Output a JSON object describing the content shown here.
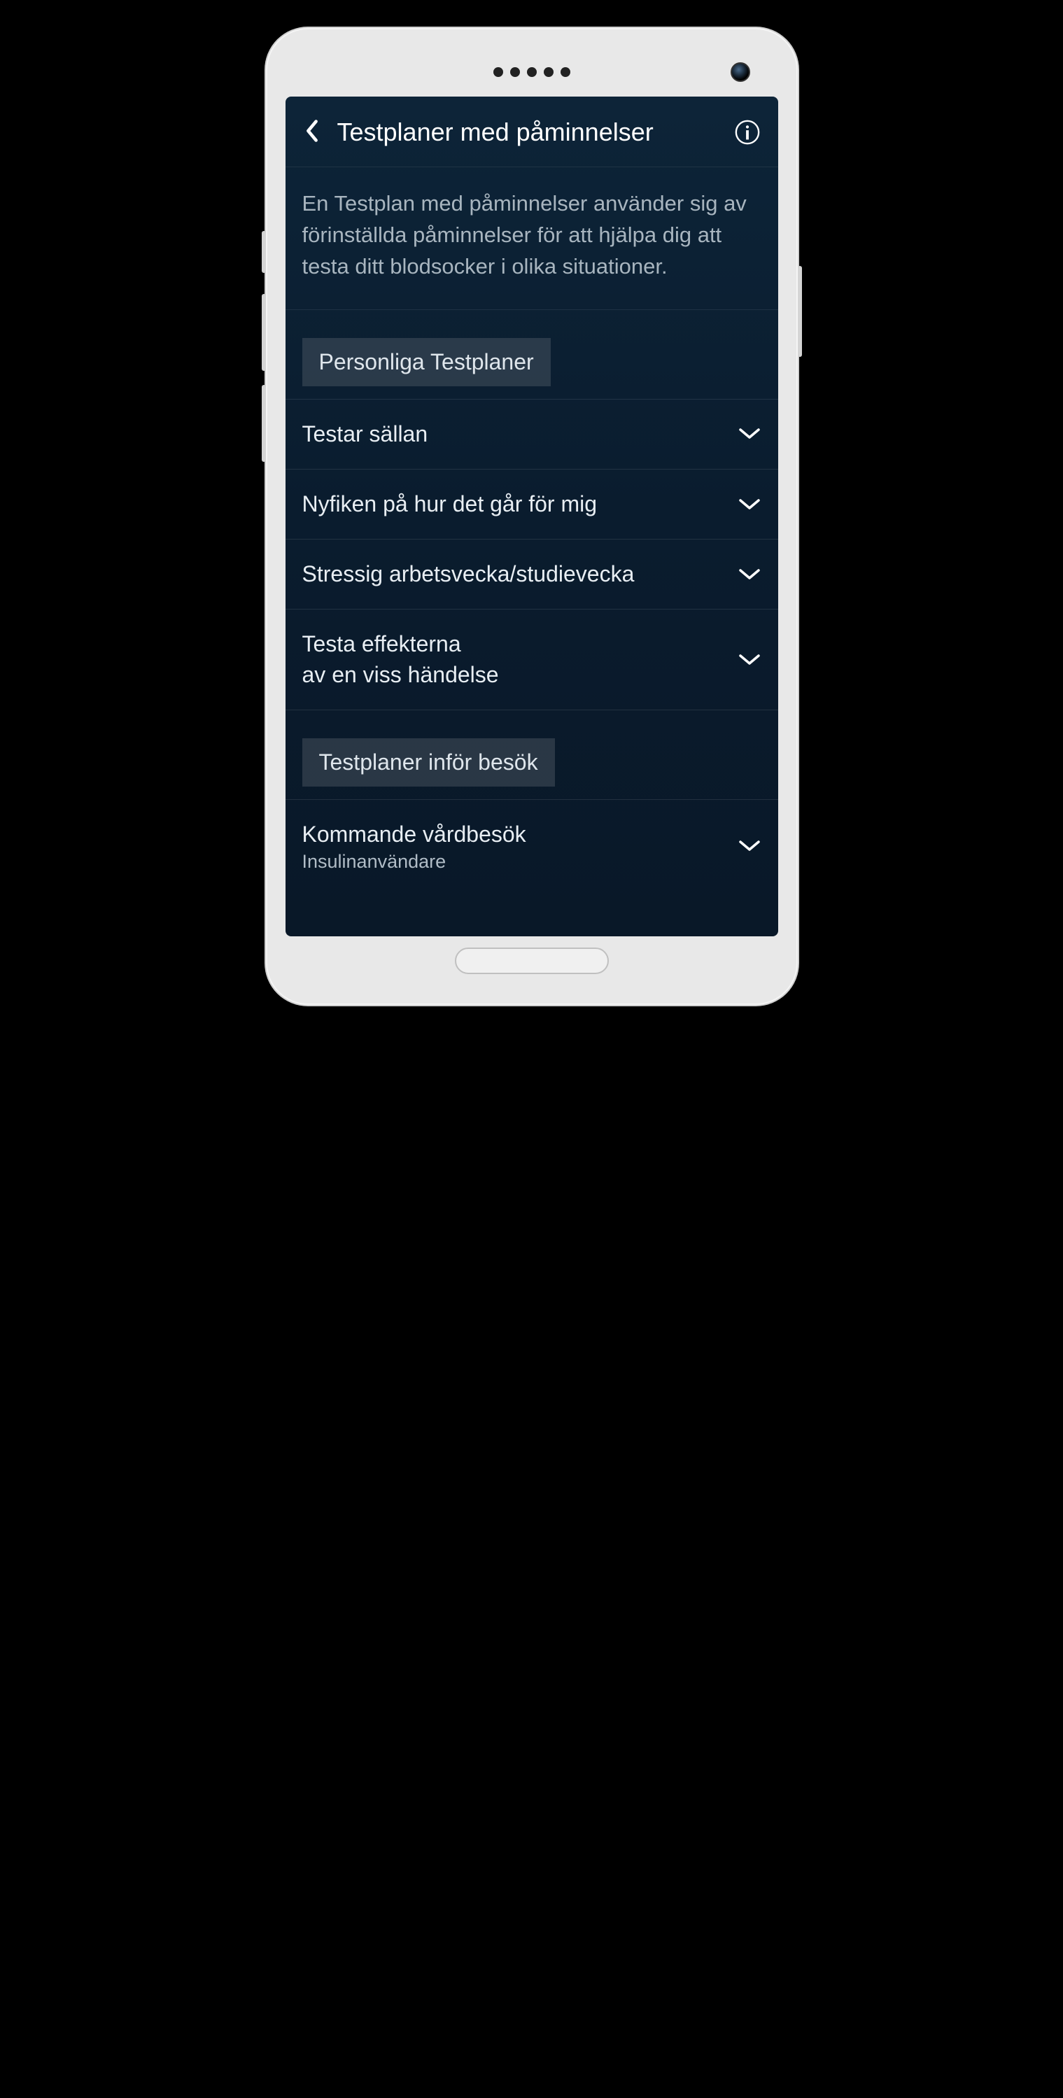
{
  "header": {
    "title": "Testplaner med påminnelser"
  },
  "description": "En Testplan med påminnelser använder sig av förinställda påminnelser för att hjälpa dig att testa ditt blodsocker i olika situationer.",
  "sections": [
    {
      "title": "Personliga Testplaner",
      "items": [
        {
          "label": "Testar sällan",
          "sublabel": ""
        },
        {
          "label": "Nyfiken på hur det går för mig",
          "sublabel": ""
        },
        {
          "label": "Stressig arbetsvecka/studievecka",
          "sublabel": ""
        },
        {
          "label": "Testa effekterna\nav en viss händelse",
          "sublabel": ""
        }
      ]
    },
    {
      "title": "Testplaner inför besök",
      "items": [
        {
          "label": "Kommande vårdbesök",
          "sublabel": "Insulinanvändare"
        }
      ]
    }
  ]
}
